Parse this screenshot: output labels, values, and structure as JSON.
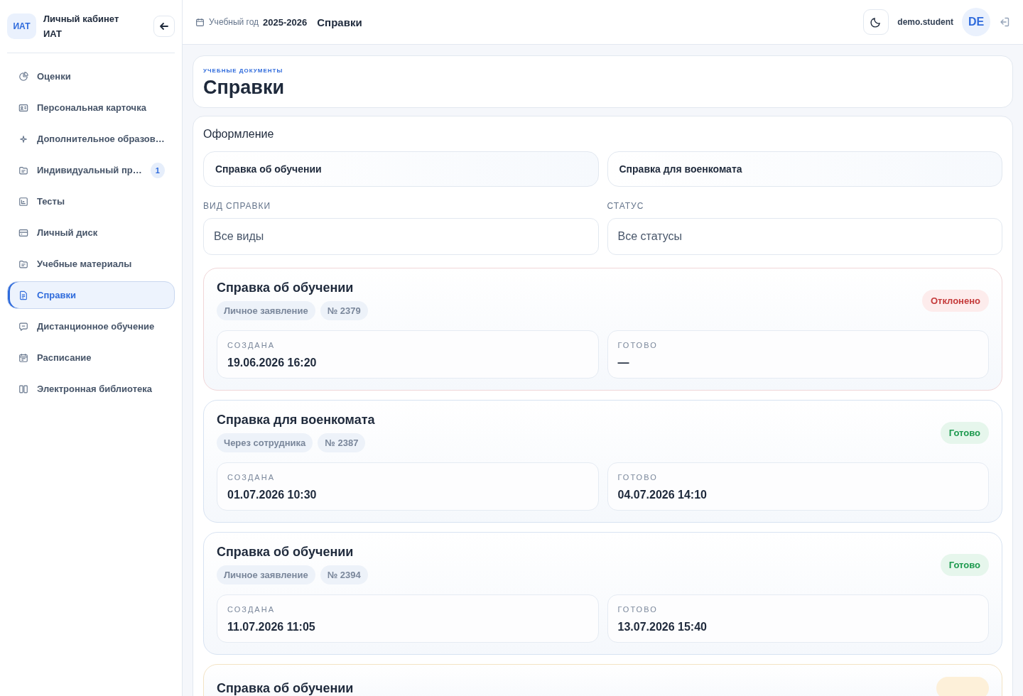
{
  "sidebar": {
    "logo": "ИАТ",
    "title": "Личный кабинет",
    "subtitle": "ИАТ",
    "items": [
      {
        "label": "Оценки",
        "selected": false
      },
      {
        "label": "Персональная карточка",
        "selected": false
      },
      {
        "label": "Дополнительное образов…",
        "selected": false
      },
      {
        "label": "Индивидуальный пр…",
        "selected": false,
        "badge": "1"
      },
      {
        "label": "Тесты",
        "selected": false
      },
      {
        "label": "Личный диск",
        "selected": false
      },
      {
        "label": "Учебные материалы",
        "selected": false
      },
      {
        "label": "Справки",
        "selected": true
      },
      {
        "label": "Дистанционное обучение",
        "selected": false
      },
      {
        "label": "Расписание",
        "selected": false
      },
      {
        "label": "Электронная библиотека",
        "selected": false
      }
    ]
  },
  "topbar": {
    "year_label": "Учебный год",
    "year": "2025-2026",
    "page_title": "Справки",
    "username": "demo.student",
    "avatar": "DE"
  },
  "header": {
    "eyebrow": "УЧЕБНЫЕ ДОКУМЕНТЫ",
    "title": "Справки"
  },
  "order": {
    "title": "Оформление",
    "buttons": [
      "Справка об обучении",
      "Справка для военкомата"
    ]
  },
  "filters": [
    {
      "label": "ВИД СПРАВКИ",
      "value": "Все виды"
    },
    {
      "label": "СТАТУС",
      "value": "Все статусы"
    }
  ],
  "requests": [
    {
      "title": "Справка об обучении",
      "tags": [
        "Личное заявление",
        "№ 2379"
      ],
      "status": {
        "kind": "rejected",
        "label": "Отклонено"
      },
      "fields": [
        {
          "label": "СОЗДАНА",
          "value": "19.06.2026 16:20"
        },
        {
          "label": "ГОТОВО",
          "value": "—"
        }
      ]
    },
    {
      "title": "Справка для военкомата",
      "tags": [
        "Через сотрудника",
        "№ 2387"
      ],
      "status": {
        "kind": "ready",
        "label": "Готово"
      },
      "fields": [
        {
          "label": "СОЗДАНА",
          "value": "01.07.2026 10:30"
        },
        {
          "label": "ГОТОВО",
          "value": "04.07.2026 14:10"
        }
      ]
    },
    {
      "title": "Справка об обучении",
      "tags": [
        "Личное заявление",
        "№ 2394"
      ],
      "status": {
        "kind": "ready",
        "label": "Готово"
      },
      "fields": [
        {
          "label": "СОЗДАНА",
          "value": "11.07.2026 11:05"
        },
        {
          "label": "ГОТОВО",
          "value": "13.07.2026 15:40"
        }
      ]
    },
    {
      "title": "Справка об обучении",
      "status": {
        "kind": "pending"
      }
    }
  ]
}
